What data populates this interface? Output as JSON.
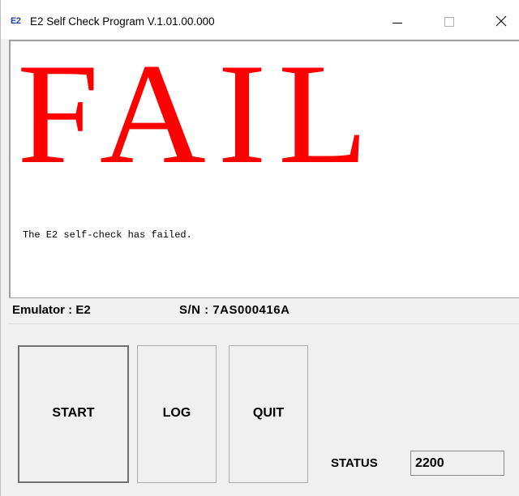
{
  "window": {
    "title": "E2 Self Check Program V.1.01.00.000",
    "app_icon_text": "E2"
  },
  "result": {
    "headline": "FAIL",
    "headline_color": "#ff0000",
    "message": "The E2 self-check has failed."
  },
  "info": {
    "emulator": "Emulator : E2",
    "serial": "S/N : 7AS000416A"
  },
  "buttons": {
    "start_label": "START",
    "log_label": "LOG",
    "quit_label": "QUIT"
  },
  "status": {
    "label": "STATUS",
    "value": "2200"
  },
  "icons": {
    "minimize": "minimize-icon",
    "maximize": "maximize-icon",
    "close": "close-icon"
  }
}
